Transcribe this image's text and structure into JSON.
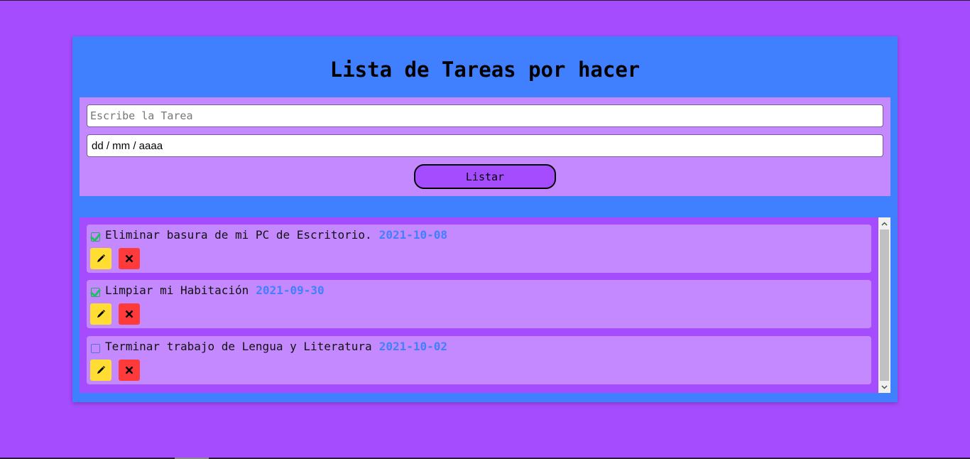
{
  "app": {
    "title": "Lista de Tareas por hacer"
  },
  "form": {
    "task_placeholder": "Escribe la Tarea",
    "task_value": "",
    "date_value": "dd / mm / aaaa",
    "submit_label": "Listar"
  },
  "tasks": [
    {
      "text": "Eliminar basura de mi PC de Escritorio.",
      "date": "2021-10-08",
      "done": true
    },
    {
      "text": "Limpiar mi Habitación",
      "date": "2021-09-30",
      "done": true
    },
    {
      "text": "Terminar trabajo de Lengua y Literatura",
      "date": "2021-10-02",
      "done": false
    }
  ],
  "icons": {
    "edit": "pencil-icon",
    "delete": "close-icon",
    "check": "checkmark-icon"
  },
  "colors": {
    "page_bg": "#a64cff",
    "card_bg": "#4080ff",
    "panel_bg": "#c589ff",
    "date_accent": "#4080ff",
    "edit_button": "#ffdd33",
    "delete_button": "#ff3a3a",
    "check_green": "#20c060"
  }
}
